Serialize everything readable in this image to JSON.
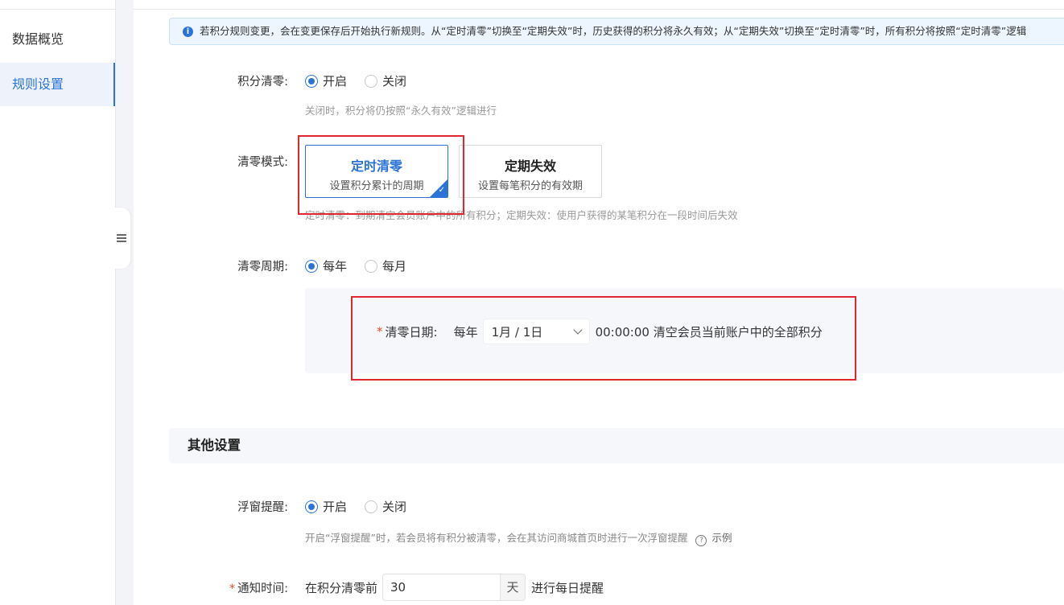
{
  "sidebar": {
    "items": [
      {
        "label": "数据概览"
      },
      {
        "label": "规则设置"
      }
    ]
  },
  "notice": {
    "text": "若积分规则变更，会在变更保存后开始执行新规则。从“定时清零”切换至“定期失效”时，历史获得的积分将永久有效；从“定期失效”切换至“定时清零”时，所有积分将按照“定时清零”逻辑"
  },
  "points_clear": {
    "label": "积分清零:",
    "options": [
      "开启",
      "关闭"
    ],
    "selected": "开启",
    "hint": "关闭时，积分将仍按照“永久有效”逻辑进行"
  },
  "clear_mode": {
    "label": "清零模式:",
    "cards": [
      {
        "title": "定时清零",
        "subtitle": "设置积分累计的周期"
      },
      {
        "title": "定期失效",
        "subtitle": "设置每笔积分的有效期"
      }
    ],
    "selected": "定时清零",
    "hint": "定时清零：到期清空会员账户中的所有积分；定期失效：使用户获得的某笔积分在一段时间后失效"
  },
  "clear_cycle": {
    "label": "清零周期:",
    "options": [
      "每年",
      "每月"
    ],
    "selected": "每年"
  },
  "clear_date": {
    "label": "清零日期:",
    "prefix": "每年",
    "value": "1月 / 1日",
    "suffix": "00:00:00 清空会员当前账户中的全部积分"
  },
  "other": {
    "title": "其他设置",
    "popup": {
      "label": "浮窗提醒:",
      "options": [
        "开启",
        "关闭"
      ],
      "selected": "开启",
      "hint": "开启“浮窗提醒”时，若会员将有积分被清零，会在其访问商城首页时进行一次浮窗提醒",
      "example": "示例"
    },
    "notify": {
      "label": "通知时间:",
      "prefix": "在积分清零前",
      "value": "30",
      "unit": "天",
      "suffix": "进行每日提醒"
    }
  },
  "colors": {
    "accent": "#2b73d6",
    "highlight_box": "#e0272f",
    "required": "#e34b2c"
  }
}
